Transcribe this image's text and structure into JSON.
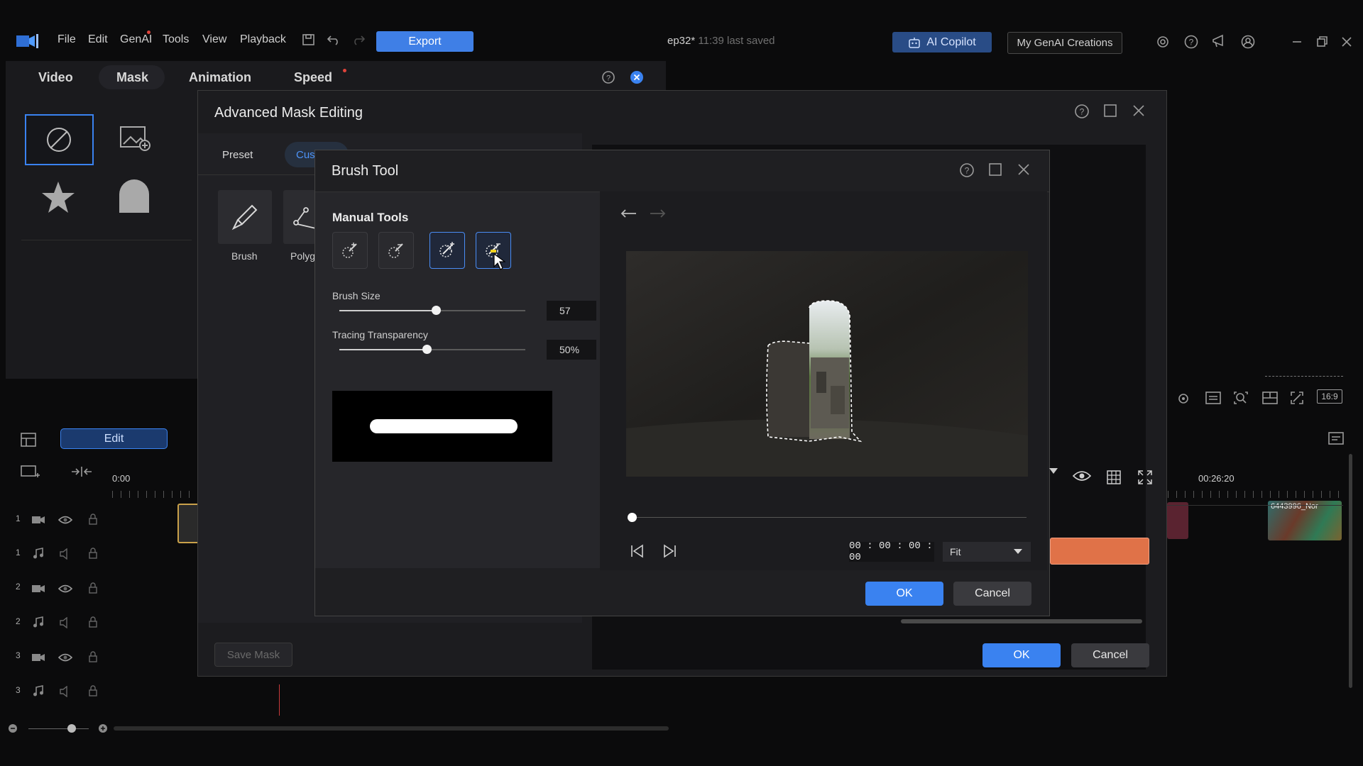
{
  "menu": {
    "items": [
      "File",
      "Edit",
      "GenAI",
      "Tools",
      "View",
      "Playback"
    ],
    "export_label": "Export",
    "project_name": "ep32*",
    "last_saved": "11:39 last saved",
    "ai_copilot_label": "AI Copilot",
    "my_genai_label": "My GenAI Creations"
  },
  "tabs": {
    "video": "Video",
    "mask": "Mask",
    "animation": "Animation",
    "speed": "Speed"
  },
  "left_panel": {
    "edit_label": "Edit",
    "time_start": "0:00",
    "tracks": [
      "1",
      "1",
      "2",
      "2",
      "3",
      "3"
    ]
  },
  "timeline": {
    "time_right": "00:26:20",
    "clip_name": "6443996_Nor"
  },
  "advanced_mask": {
    "title": "Advanced Mask Editing",
    "tab_preset": "Preset",
    "tab_custom": "Cus",
    "tool_brush_label": "Brush",
    "tool_polygon_label": "Polyg",
    "save_mask_label": "Save Mask",
    "ok_label": "OK",
    "cancel_label": "Cancel",
    "preview_aspect": "16:9"
  },
  "brush_tool": {
    "title": "Brush Tool",
    "section_label": "Manual Tools",
    "brush_size_label": "Brush Size",
    "brush_size_value": "57",
    "brush_size_fraction": 0.52,
    "tracing_label": "Tracing Transparency",
    "tracing_value": "50%",
    "tracing_fraction": 0.47,
    "timecode": "00 : 00 : 00 : 00",
    "zoom_option": "Fit",
    "ok_label": "OK",
    "cancel_label": "Cancel",
    "active_tools": [
      "smart-brush",
      "smart-eraser"
    ]
  },
  "colors": {
    "accent": "#3a82f0",
    "clip_orange": "#e0704a",
    "bg": "#0b0b0c"
  }
}
